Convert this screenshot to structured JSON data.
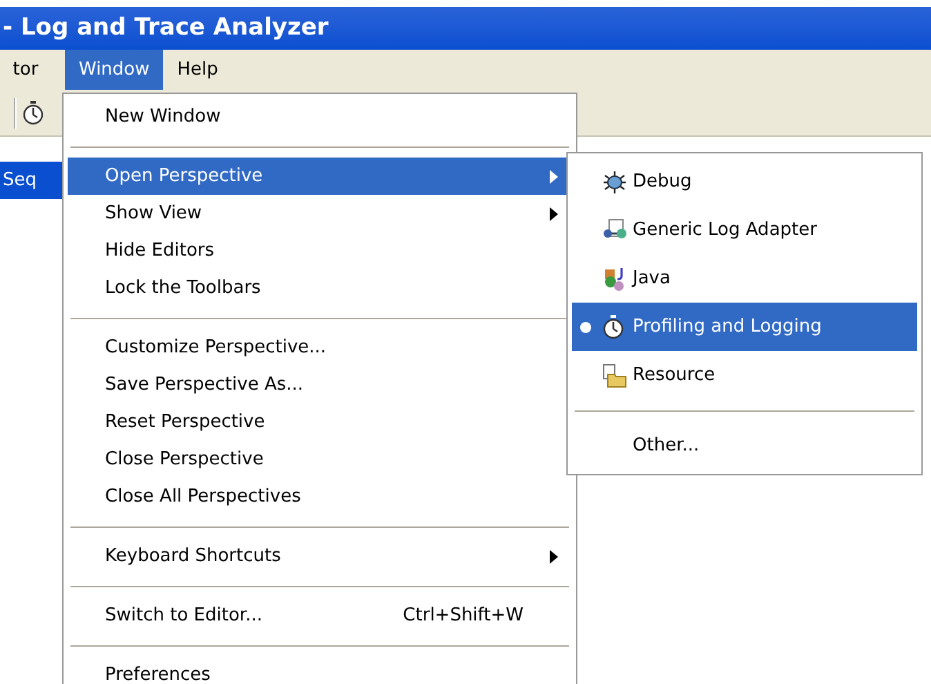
{
  "window": {
    "title": "- Log and Trace Analyzer"
  },
  "menu_bar": [
    {
      "label": "tor",
      "selected": false
    },
    {
      "label": "Window",
      "selected": true
    },
    {
      "label": "Help",
      "selected": false
    }
  ],
  "view_tab": {
    "label": "Seq"
  },
  "window_menu": [
    {
      "kind": "item",
      "label": "New Window",
      "submenu": false,
      "selected": false
    },
    {
      "kind": "separator"
    },
    {
      "kind": "item",
      "label": "Open Perspective",
      "submenu": true,
      "selected": true
    },
    {
      "kind": "item",
      "label": "Show View",
      "submenu": true,
      "selected": false
    },
    {
      "kind": "item",
      "label": "Hide Editors",
      "submenu": false,
      "selected": false
    },
    {
      "kind": "item",
      "label": "Lock the Toolbars",
      "submenu": false,
      "selected": false
    },
    {
      "kind": "separator"
    },
    {
      "kind": "item",
      "label": "Customize Perspective...",
      "submenu": false,
      "selected": false
    },
    {
      "kind": "item",
      "label": "Save Perspective As...",
      "submenu": false,
      "selected": false
    },
    {
      "kind": "item",
      "label": "Reset Perspective",
      "submenu": false,
      "selected": false
    },
    {
      "kind": "item",
      "label": "Close Perspective",
      "submenu": false,
      "selected": false
    },
    {
      "kind": "item",
      "label": "Close All Perspectives",
      "submenu": false,
      "selected": false
    },
    {
      "kind": "separator"
    },
    {
      "kind": "item",
      "label": "Keyboard Shortcuts",
      "submenu": true,
      "selected": false
    },
    {
      "kind": "separator"
    },
    {
      "kind": "item",
      "label": "Switch to Editor...",
      "shortcut": "Ctrl+Shift+W",
      "submenu": false,
      "selected": false
    },
    {
      "kind": "separator"
    },
    {
      "kind": "item",
      "label": "Preferences",
      "submenu": false,
      "selected": false
    }
  ],
  "perspective_menu": [
    {
      "kind": "item",
      "label": "Debug",
      "checked": false,
      "selected": false
    },
    {
      "kind": "item",
      "label": "Generic Log Adapter",
      "checked": false,
      "selected": false
    },
    {
      "kind": "item",
      "label": "Java",
      "checked": false,
      "selected": false
    },
    {
      "kind": "item",
      "label": "Profiling and Logging",
      "checked": true,
      "selected": true
    },
    {
      "kind": "item",
      "label": "Resource",
      "checked": false,
      "selected": false
    },
    {
      "kind": "separator"
    },
    {
      "kind": "item",
      "label": "Other...",
      "checked": false,
      "selected": false
    }
  ]
}
